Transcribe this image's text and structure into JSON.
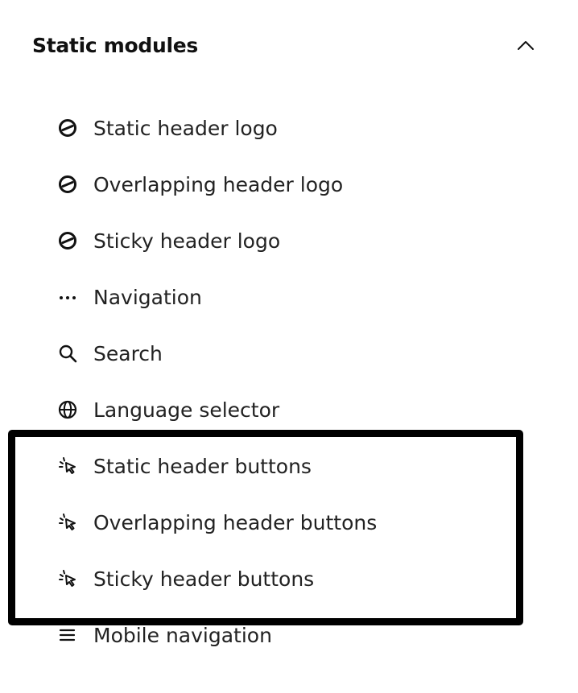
{
  "section": {
    "title": "Static modules",
    "toggle_icon": "chevron-up-icon",
    "expanded": true
  },
  "items": [
    {
      "label": "Static header logo",
      "icon": "logo-icon"
    },
    {
      "label": "Overlapping header logo",
      "icon": "logo-icon"
    },
    {
      "label": "Sticky header logo",
      "icon": "logo-icon"
    },
    {
      "label": "Navigation",
      "icon": "ellipsis-icon"
    },
    {
      "label": "Search",
      "icon": "search-icon"
    },
    {
      "label": "Language selector",
      "icon": "globe-icon"
    },
    {
      "label": "Static header buttons",
      "icon": "cursor-click-icon"
    },
    {
      "label": "Overlapping header buttons",
      "icon": "cursor-click-icon"
    },
    {
      "label": "Sticky header buttons",
      "icon": "cursor-click-icon"
    },
    {
      "label": "Mobile navigation",
      "icon": "menu-icon"
    }
  ],
  "highlight": {
    "border_color": "#000000"
  },
  "colors": {
    "text": "#222222",
    "background": "#ffffff"
  }
}
